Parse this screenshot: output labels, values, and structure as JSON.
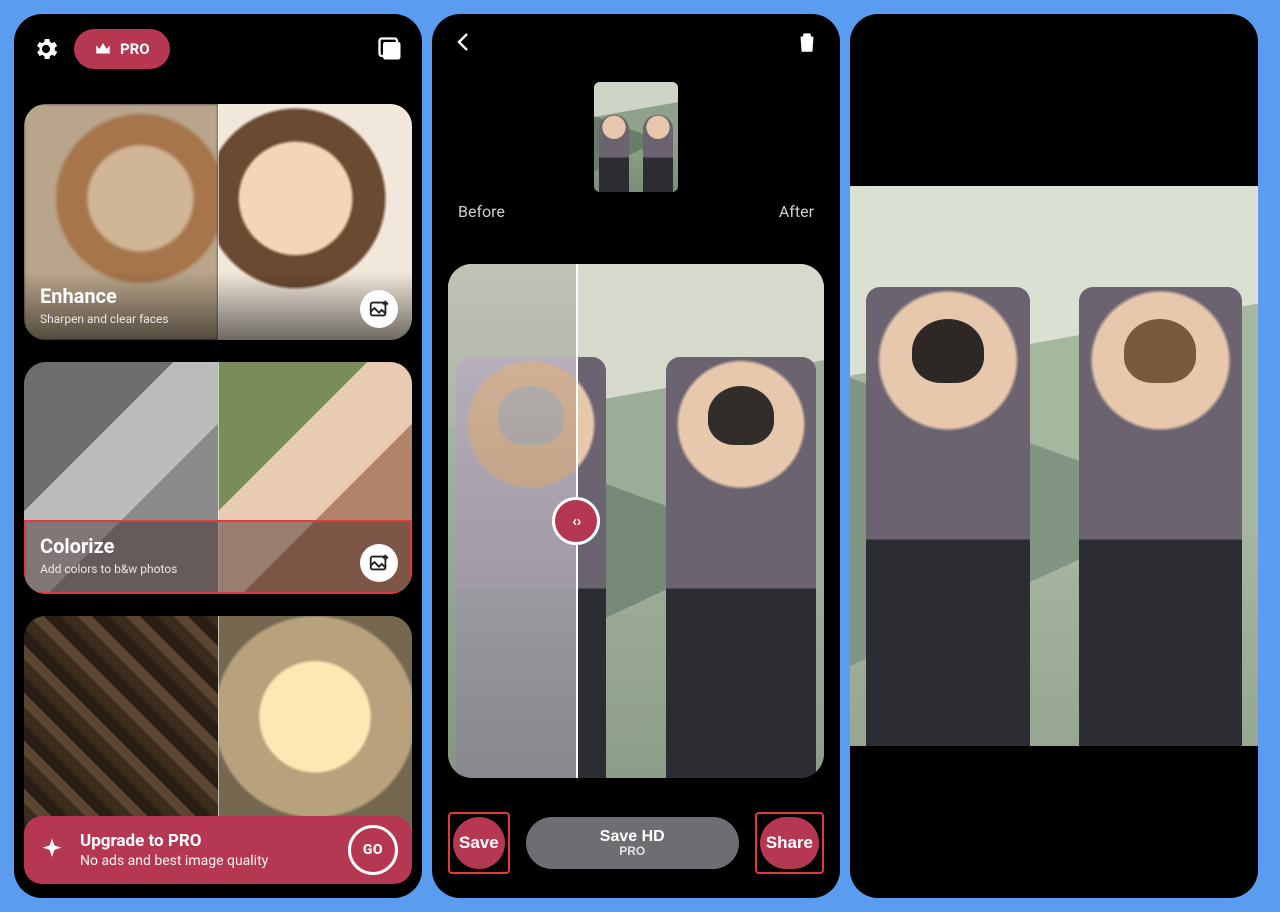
{
  "screen1": {
    "pro_label": "PRO",
    "cards": {
      "enhance": {
        "title": "Enhance",
        "subtitle": "Sharpen and clear faces"
      },
      "colorize": {
        "title": "Colorize",
        "subtitle": "Add colors to b&w photos"
      }
    },
    "pro_banner": {
      "title": "Upgrade to PRO",
      "subtitle": "No ads and best image quality",
      "go": "GO"
    }
  },
  "screen2": {
    "before": "Before",
    "after": "After",
    "slider_glyph": "‹ ›",
    "buttons": {
      "save": "Save",
      "save_hd": "Save HD",
      "save_hd_sub": "PRO",
      "share": "Share"
    }
  }
}
